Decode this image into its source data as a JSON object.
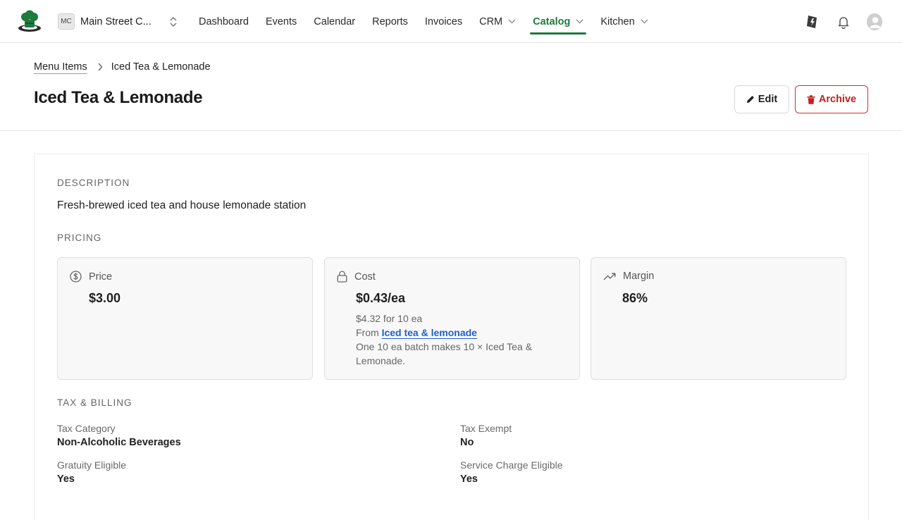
{
  "org": {
    "badge": "MC",
    "name": "Main Street C..."
  },
  "nav": {
    "items": [
      {
        "label": "Dashboard"
      },
      {
        "label": "Events"
      },
      {
        "label": "Calendar"
      },
      {
        "label": "Reports"
      },
      {
        "label": "Invoices"
      },
      {
        "label": "CRM",
        "dropdown": true
      },
      {
        "label": "Catalog",
        "dropdown": true,
        "active": true
      },
      {
        "label": "Kitchen",
        "dropdown": true
      }
    ]
  },
  "breadcrumb": {
    "parent": "Menu Items",
    "current": "Iced Tea & Lemonade"
  },
  "page": {
    "title": "Iced Tea & Lemonade"
  },
  "actions": {
    "edit_label": "Edit",
    "archive_label": "Archive"
  },
  "description": {
    "label": "DESCRIPTION",
    "text": "Fresh-brewed iced tea and house lemonade station"
  },
  "pricing": {
    "label": "PRICING",
    "price": {
      "label": "Price",
      "value": "$3.00"
    },
    "cost": {
      "label": "Cost",
      "value": "$0.43/ea",
      "batch_cost": "$4.32 for 10 ea",
      "from_prefix": "From ",
      "from_link": "Iced tea & lemonade",
      "batch_line1": "One 10 ea batch makes 10 × Iced Tea &",
      "batch_line2": "Lemonade."
    },
    "margin": {
      "label": "Margin",
      "value": "86%"
    }
  },
  "tax": {
    "label": "TAX & BILLING",
    "tax_category": {
      "label": "Tax Category",
      "value": "Non-Alcoholic Beverages"
    },
    "tax_exempt": {
      "label": "Tax Exempt",
      "value": "No"
    },
    "gratuity": {
      "label": "Gratuity Eligible",
      "value": "Yes"
    },
    "service_charge": {
      "label": "Service Charge Eligible",
      "value": "Yes"
    }
  },
  "colors": {
    "accent": "#1e7a3d",
    "danger": "#c81e1e",
    "link": "#1f5fcf"
  }
}
